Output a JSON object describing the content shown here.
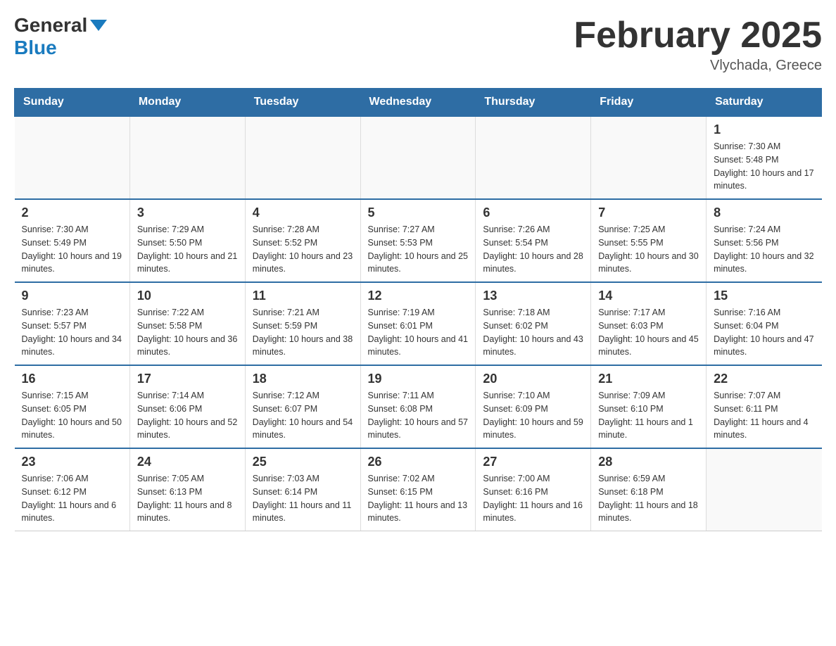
{
  "header": {
    "logo_general": "General",
    "logo_blue": "Blue",
    "month_title": "February 2025",
    "location": "Vlychada, Greece"
  },
  "days_of_week": [
    "Sunday",
    "Monday",
    "Tuesday",
    "Wednesday",
    "Thursday",
    "Friday",
    "Saturday"
  ],
  "weeks": [
    {
      "cells": [
        {
          "day": null
        },
        {
          "day": null
        },
        {
          "day": null
        },
        {
          "day": null
        },
        {
          "day": null
        },
        {
          "day": null
        },
        {
          "day": "1",
          "sunrise": "7:30 AM",
          "sunset": "5:48 PM",
          "daylight": "10 hours and 17 minutes."
        }
      ]
    },
    {
      "cells": [
        {
          "day": "2",
          "sunrise": "7:30 AM",
          "sunset": "5:49 PM",
          "daylight": "10 hours and 19 minutes."
        },
        {
          "day": "3",
          "sunrise": "7:29 AM",
          "sunset": "5:50 PM",
          "daylight": "10 hours and 21 minutes."
        },
        {
          "day": "4",
          "sunrise": "7:28 AM",
          "sunset": "5:52 PM",
          "daylight": "10 hours and 23 minutes."
        },
        {
          "day": "5",
          "sunrise": "7:27 AM",
          "sunset": "5:53 PM",
          "daylight": "10 hours and 25 minutes."
        },
        {
          "day": "6",
          "sunrise": "7:26 AM",
          "sunset": "5:54 PM",
          "daylight": "10 hours and 28 minutes."
        },
        {
          "day": "7",
          "sunrise": "7:25 AM",
          "sunset": "5:55 PM",
          "daylight": "10 hours and 30 minutes."
        },
        {
          "day": "8",
          "sunrise": "7:24 AM",
          "sunset": "5:56 PM",
          "daylight": "10 hours and 32 minutes."
        }
      ]
    },
    {
      "cells": [
        {
          "day": "9",
          "sunrise": "7:23 AM",
          "sunset": "5:57 PM",
          "daylight": "10 hours and 34 minutes."
        },
        {
          "day": "10",
          "sunrise": "7:22 AM",
          "sunset": "5:58 PM",
          "daylight": "10 hours and 36 minutes."
        },
        {
          "day": "11",
          "sunrise": "7:21 AM",
          "sunset": "5:59 PM",
          "daylight": "10 hours and 38 minutes."
        },
        {
          "day": "12",
          "sunrise": "7:19 AM",
          "sunset": "6:01 PM",
          "daylight": "10 hours and 41 minutes."
        },
        {
          "day": "13",
          "sunrise": "7:18 AM",
          "sunset": "6:02 PM",
          "daylight": "10 hours and 43 minutes."
        },
        {
          "day": "14",
          "sunrise": "7:17 AM",
          "sunset": "6:03 PM",
          "daylight": "10 hours and 45 minutes."
        },
        {
          "day": "15",
          "sunrise": "7:16 AM",
          "sunset": "6:04 PM",
          "daylight": "10 hours and 47 minutes."
        }
      ]
    },
    {
      "cells": [
        {
          "day": "16",
          "sunrise": "7:15 AM",
          "sunset": "6:05 PM",
          "daylight": "10 hours and 50 minutes."
        },
        {
          "day": "17",
          "sunrise": "7:14 AM",
          "sunset": "6:06 PM",
          "daylight": "10 hours and 52 minutes."
        },
        {
          "day": "18",
          "sunrise": "7:12 AM",
          "sunset": "6:07 PM",
          "daylight": "10 hours and 54 minutes."
        },
        {
          "day": "19",
          "sunrise": "7:11 AM",
          "sunset": "6:08 PM",
          "daylight": "10 hours and 57 minutes."
        },
        {
          "day": "20",
          "sunrise": "7:10 AM",
          "sunset": "6:09 PM",
          "daylight": "10 hours and 59 minutes."
        },
        {
          "day": "21",
          "sunrise": "7:09 AM",
          "sunset": "6:10 PM",
          "daylight": "11 hours and 1 minute."
        },
        {
          "day": "22",
          "sunrise": "7:07 AM",
          "sunset": "6:11 PM",
          "daylight": "11 hours and 4 minutes."
        }
      ]
    },
    {
      "cells": [
        {
          "day": "23",
          "sunrise": "7:06 AM",
          "sunset": "6:12 PM",
          "daylight": "11 hours and 6 minutes."
        },
        {
          "day": "24",
          "sunrise": "7:05 AM",
          "sunset": "6:13 PM",
          "daylight": "11 hours and 8 minutes."
        },
        {
          "day": "25",
          "sunrise": "7:03 AM",
          "sunset": "6:14 PM",
          "daylight": "11 hours and 11 minutes."
        },
        {
          "day": "26",
          "sunrise": "7:02 AM",
          "sunset": "6:15 PM",
          "daylight": "11 hours and 13 minutes."
        },
        {
          "day": "27",
          "sunrise": "7:00 AM",
          "sunset": "6:16 PM",
          "daylight": "11 hours and 16 minutes."
        },
        {
          "day": "28",
          "sunrise": "6:59 AM",
          "sunset": "6:18 PM",
          "daylight": "11 hours and 18 minutes."
        },
        {
          "day": null
        }
      ]
    }
  ]
}
